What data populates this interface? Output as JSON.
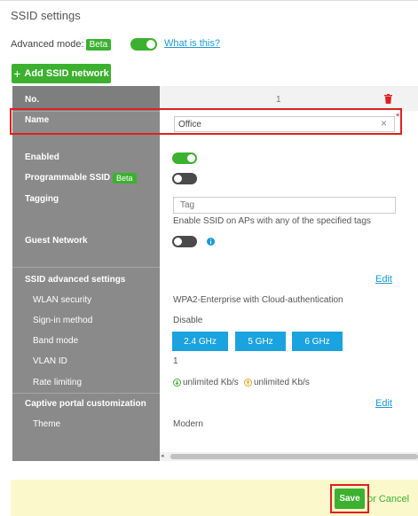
{
  "page": {
    "title": "SSID settings"
  },
  "advanced": {
    "label": "Advanced mode:",
    "badge": "Beta",
    "toggle_on": true,
    "link": "What is this?"
  },
  "add_button": {
    "label": "Add SSID network",
    "icon": "plus-icon"
  },
  "table": {
    "header_label": "No.",
    "header_value": "1",
    "delete_icon": "trash-icon",
    "name_label": "Name",
    "name_value": "Office",
    "required_mark": "*",
    "enabled_label": "Enabled",
    "enabled_on": true,
    "programmable_label": "Programmable SSID",
    "programmable_badge": "Beta",
    "programmable_on": false,
    "tagging_label": "Tagging",
    "tagging_placeholder": "Tag",
    "tagging_help": "Enable SSID on APs with any of the specified tags",
    "guest_label": "Guest Network",
    "guest_on": false,
    "advanced_section_label": "SSID advanced settings",
    "advanced_edit": "Edit",
    "wlan_security_label": "WLAN security",
    "wlan_security_value": "WPA2-Enterprise with Cloud-authentication",
    "signin_label": "Sign-in method",
    "signin_value": "Disable",
    "band_label": "Band mode",
    "bands": [
      "2.4 GHz",
      "5 GHz",
      "6 GHz"
    ],
    "vlan_label": "VLAN ID",
    "vlan_value": "1",
    "rate_label": "Rate limiting",
    "rate_down": "unlimited Kb/s",
    "rate_up": "unlimited Kb/s",
    "captive_label": "Captive portal customization",
    "captive_edit": "Edit",
    "theme_label": "Theme",
    "theme_value": "Modern"
  },
  "footer": {
    "save": "Save",
    "cancel": "or Cancel"
  },
  "colors": {
    "accent_green": "#3cb12f",
    "link_blue": "#1a9ad6",
    "band_blue": "#1ba3e0",
    "highlight_red": "#e02020",
    "footer_bg": "#fbf8cc"
  }
}
